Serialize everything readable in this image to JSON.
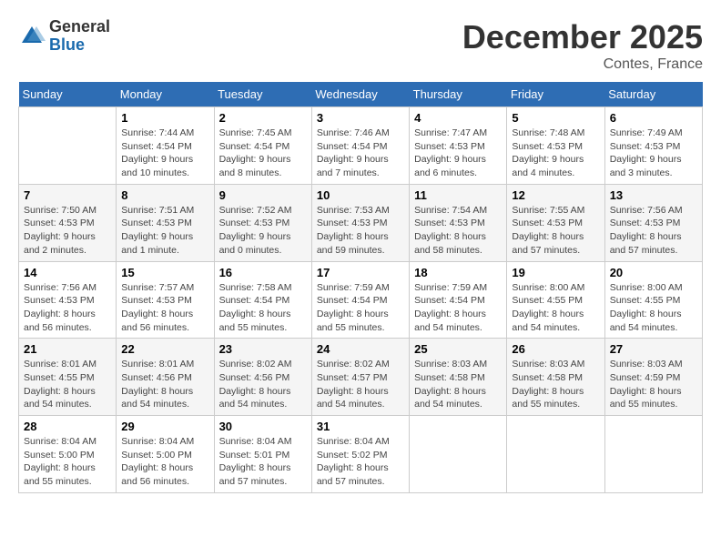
{
  "header": {
    "logo_general": "General",
    "logo_blue": "Blue",
    "month_title": "December 2025",
    "subtitle": "Contes, France"
  },
  "days_of_week": [
    "Sunday",
    "Monday",
    "Tuesday",
    "Wednesday",
    "Thursday",
    "Friday",
    "Saturday"
  ],
  "weeks": [
    [
      {
        "day": "",
        "sunrise": "",
        "sunset": "",
        "daylight": ""
      },
      {
        "day": "1",
        "sunrise": "Sunrise: 7:44 AM",
        "sunset": "Sunset: 4:54 PM",
        "daylight": "Daylight: 9 hours and 10 minutes."
      },
      {
        "day": "2",
        "sunrise": "Sunrise: 7:45 AM",
        "sunset": "Sunset: 4:54 PM",
        "daylight": "Daylight: 9 hours and 8 minutes."
      },
      {
        "day": "3",
        "sunrise": "Sunrise: 7:46 AM",
        "sunset": "Sunset: 4:54 PM",
        "daylight": "Daylight: 9 hours and 7 minutes."
      },
      {
        "day": "4",
        "sunrise": "Sunrise: 7:47 AM",
        "sunset": "Sunset: 4:53 PM",
        "daylight": "Daylight: 9 hours and 6 minutes."
      },
      {
        "day": "5",
        "sunrise": "Sunrise: 7:48 AM",
        "sunset": "Sunset: 4:53 PM",
        "daylight": "Daylight: 9 hours and 4 minutes."
      },
      {
        "day": "6",
        "sunrise": "Sunrise: 7:49 AM",
        "sunset": "Sunset: 4:53 PM",
        "daylight": "Daylight: 9 hours and 3 minutes."
      }
    ],
    [
      {
        "day": "7",
        "sunrise": "Sunrise: 7:50 AM",
        "sunset": "Sunset: 4:53 PM",
        "daylight": "Daylight: 9 hours and 2 minutes."
      },
      {
        "day": "8",
        "sunrise": "Sunrise: 7:51 AM",
        "sunset": "Sunset: 4:53 PM",
        "daylight": "Daylight: 9 hours and 1 minute."
      },
      {
        "day": "9",
        "sunrise": "Sunrise: 7:52 AM",
        "sunset": "Sunset: 4:53 PM",
        "daylight": "Daylight: 9 hours and 0 minutes."
      },
      {
        "day": "10",
        "sunrise": "Sunrise: 7:53 AM",
        "sunset": "Sunset: 4:53 PM",
        "daylight": "Daylight: 8 hours and 59 minutes."
      },
      {
        "day": "11",
        "sunrise": "Sunrise: 7:54 AM",
        "sunset": "Sunset: 4:53 PM",
        "daylight": "Daylight: 8 hours and 58 minutes."
      },
      {
        "day": "12",
        "sunrise": "Sunrise: 7:55 AM",
        "sunset": "Sunset: 4:53 PM",
        "daylight": "Daylight: 8 hours and 57 minutes."
      },
      {
        "day": "13",
        "sunrise": "Sunrise: 7:56 AM",
        "sunset": "Sunset: 4:53 PM",
        "daylight": "Daylight: 8 hours and 57 minutes."
      }
    ],
    [
      {
        "day": "14",
        "sunrise": "Sunrise: 7:56 AM",
        "sunset": "Sunset: 4:53 PM",
        "daylight": "Daylight: 8 hours and 56 minutes."
      },
      {
        "day": "15",
        "sunrise": "Sunrise: 7:57 AM",
        "sunset": "Sunset: 4:53 PM",
        "daylight": "Daylight: 8 hours and 56 minutes."
      },
      {
        "day": "16",
        "sunrise": "Sunrise: 7:58 AM",
        "sunset": "Sunset: 4:54 PM",
        "daylight": "Daylight: 8 hours and 55 minutes."
      },
      {
        "day": "17",
        "sunrise": "Sunrise: 7:59 AM",
        "sunset": "Sunset: 4:54 PM",
        "daylight": "Daylight: 8 hours and 55 minutes."
      },
      {
        "day": "18",
        "sunrise": "Sunrise: 7:59 AM",
        "sunset": "Sunset: 4:54 PM",
        "daylight": "Daylight: 8 hours and 54 minutes."
      },
      {
        "day": "19",
        "sunrise": "Sunrise: 8:00 AM",
        "sunset": "Sunset: 4:55 PM",
        "daylight": "Daylight: 8 hours and 54 minutes."
      },
      {
        "day": "20",
        "sunrise": "Sunrise: 8:00 AM",
        "sunset": "Sunset: 4:55 PM",
        "daylight": "Daylight: 8 hours and 54 minutes."
      }
    ],
    [
      {
        "day": "21",
        "sunrise": "Sunrise: 8:01 AM",
        "sunset": "Sunset: 4:55 PM",
        "daylight": "Daylight: 8 hours and 54 minutes."
      },
      {
        "day": "22",
        "sunrise": "Sunrise: 8:01 AM",
        "sunset": "Sunset: 4:56 PM",
        "daylight": "Daylight: 8 hours and 54 minutes."
      },
      {
        "day": "23",
        "sunrise": "Sunrise: 8:02 AM",
        "sunset": "Sunset: 4:56 PM",
        "daylight": "Daylight: 8 hours and 54 minutes."
      },
      {
        "day": "24",
        "sunrise": "Sunrise: 8:02 AM",
        "sunset": "Sunset: 4:57 PM",
        "daylight": "Daylight: 8 hours and 54 minutes."
      },
      {
        "day": "25",
        "sunrise": "Sunrise: 8:03 AM",
        "sunset": "Sunset: 4:58 PM",
        "daylight": "Daylight: 8 hours and 54 minutes."
      },
      {
        "day": "26",
        "sunrise": "Sunrise: 8:03 AM",
        "sunset": "Sunset: 4:58 PM",
        "daylight": "Daylight: 8 hours and 55 minutes."
      },
      {
        "day": "27",
        "sunrise": "Sunrise: 8:03 AM",
        "sunset": "Sunset: 4:59 PM",
        "daylight": "Daylight: 8 hours and 55 minutes."
      }
    ],
    [
      {
        "day": "28",
        "sunrise": "Sunrise: 8:04 AM",
        "sunset": "Sunset: 5:00 PM",
        "daylight": "Daylight: 8 hours and 55 minutes."
      },
      {
        "day": "29",
        "sunrise": "Sunrise: 8:04 AM",
        "sunset": "Sunset: 5:00 PM",
        "daylight": "Daylight: 8 hours and 56 minutes."
      },
      {
        "day": "30",
        "sunrise": "Sunrise: 8:04 AM",
        "sunset": "Sunset: 5:01 PM",
        "daylight": "Daylight: 8 hours and 57 minutes."
      },
      {
        "day": "31",
        "sunrise": "Sunrise: 8:04 AM",
        "sunset": "Sunset: 5:02 PM",
        "daylight": "Daylight: 8 hours and 57 minutes."
      },
      {
        "day": "",
        "sunrise": "",
        "sunset": "",
        "daylight": ""
      },
      {
        "day": "",
        "sunrise": "",
        "sunset": "",
        "daylight": ""
      },
      {
        "day": "",
        "sunrise": "",
        "sunset": "",
        "daylight": ""
      }
    ]
  ]
}
